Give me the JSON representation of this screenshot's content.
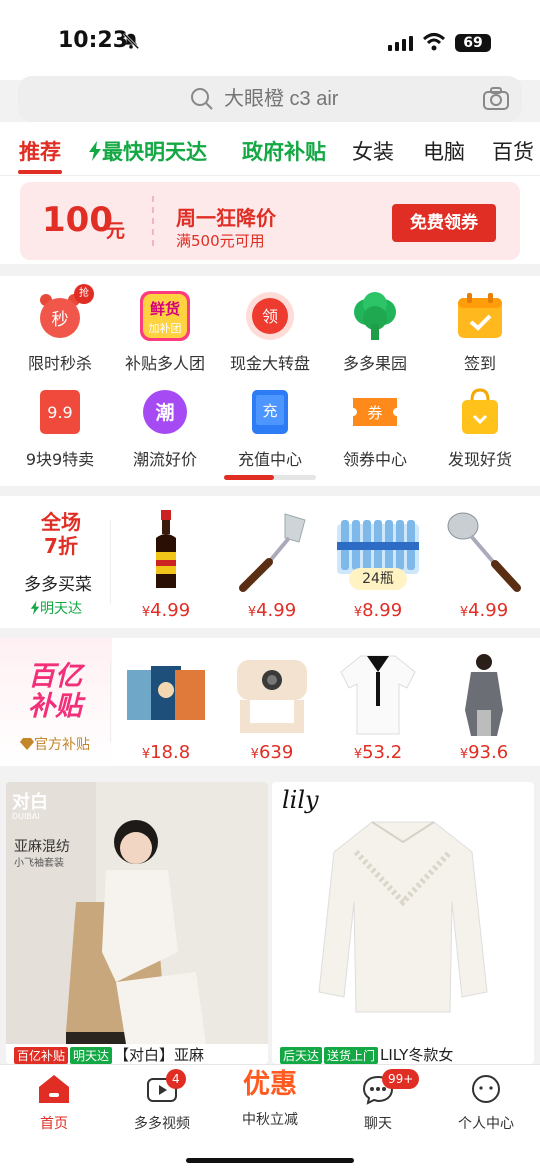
{
  "status": {
    "time": "10:23",
    "battery": "69"
  },
  "search": {
    "placeholder": "大眼橙 c3 air"
  },
  "tabs": [
    {
      "label": "推荐"
    },
    {
      "label": "最快明天达"
    },
    {
      "label": "政府补贴"
    },
    {
      "label": "女装"
    },
    {
      "label": "电脑"
    },
    {
      "label": "百货"
    }
  ],
  "coupon": {
    "amount": "100",
    "unit": "元",
    "title": "周一狂降价",
    "condition": "满500元可用",
    "button": "免费领券"
  },
  "grid": [
    {
      "label": "限时秒杀",
      "icon_text": "秒",
      "badge": "抢"
    },
    {
      "label": "补贴多人团",
      "icon_text": "鲜货",
      "icon_text2": "加补团"
    },
    {
      "label": "现金大转盘",
      "icon_text": "领"
    },
    {
      "label": "多多果园"
    },
    {
      "label": "签到"
    },
    {
      "label": "9块9特卖",
      "icon_text": "9.9"
    },
    {
      "label": "潮流好价",
      "icon_text": "潮"
    },
    {
      "label": "充值中心",
      "icon_text": "充"
    },
    {
      "label": "领券中心",
      "icon_text": "券"
    },
    {
      "label": "发现好货"
    }
  ],
  "grocery": {
    "promo_line1": "全场",
    "promo_line2": "7折",
    "title": "多多买菜",
    "subtitle": "明天达",
    "products": [
      {
        "price": "4.99",
        "name": "soy-sauce"
      },
      {
        "price": "4.99",
        "name": "spatula"
      },
      {
        "price": "8.99",
        "name": "water-pack",
        "tag": "24瓶"
      },
      {
        "price": "4.99",
        "name": "ladle"
      }
    ]
  },
  "subsidy": {
    "title_line1": "百亿",
    "title_line2": "补贴",
    "subtitle": "官方补贴",
    "products": [
      {
        "price": "18.8"
      },
      {
        "price": "639"
      },
      {
        "price": "53.2"
      },
      {
        "price": "93.6"
      }
    ]
  },
  "cards": [
    {
      "brand": "对白",
      "brand_sub": "DUIBAI",
      "desc1": "亚麻混纺",
      "desc2": "小飞袖套装",
      "tag1": "百亿补贴",
      "tag2": "明天达",
      "caption": "【对白】亚麻"
    },
    {
      "brand": "lily",
      "tag1": "后天达",
      "tag2": "送货上门",
      "caption": "LILY冬款女"
    }
  ],
  "nav": [
    {
      "label": "首页"
    },
    {
      "label": "多多视频",
      "badge": "4"
    },
    {
      "label": "中秋立减",
      "big": "优惠"
    },
    {
      "label": "聊天",
      "badge": "99+"
    },
    {
      "label": "个人中心"
    }
  ],
  "colors": {
    "brand_red": "#e02e24",
    "green": "#14a844"
  },
  "currency": "¥"
}
